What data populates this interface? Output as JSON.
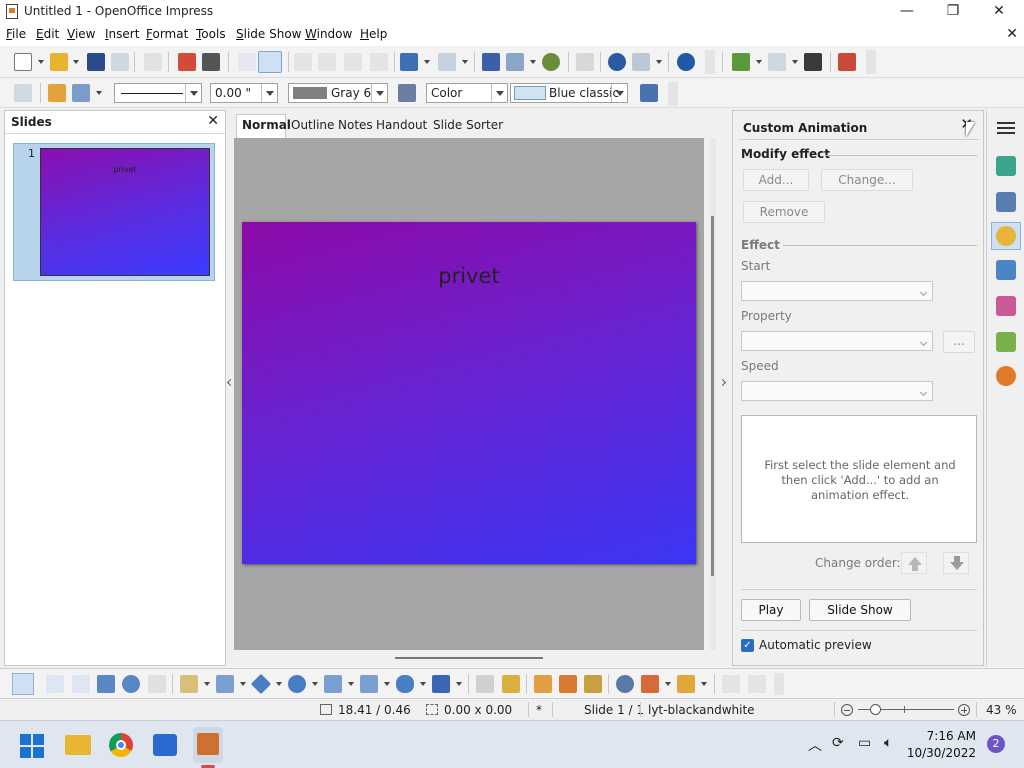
{
  "window": {
    "title": "Untitled 1 - OpenOffice Impress",
    "minimize": "—",
    "maximize": "❐",
    "close": "✕"
  },
  "menu": [
    "File",
    "Edit",
    "View",
    "Insert",
    "Format",
    "Tools",
    "Slide Show",
    "Window",
    "Help"
  ],
  "doc_close": "✕",
  "line_toolbar": {
    "line_width": "0.00 \"",
    "line_color": "Gray 6",
    "area_style": "Color",
    "area_color": "Blue classic"
  },
  "slides_panel": {
    "title": "Slides",
    "close": "✕",
    "slide_number": "1",
    "thumb_text": "privet"
  },
  "view_tabs": [
    "Normal",
    "Outline",
    "Notes",
    "Handout",
    "Slide Sorter"
  ],
  "slide": {
    "title_text": "privet"
  },
  "animation_panel": {
    "title": "Custom Animation",
    "close": "✕",
    "modify_effect": "Modify effect",
    "add": "Add...",
    "change": "Change...",
    "remove": "Remove",
    "effect": "Effect",
    "start": "Start",
    "property": "Property",
    "property_more": "...",
    "speed": "Speed",
    "hint": "First select the slide element and then click 'Add...' to add an animation effect.",
    "change_order": "Change order:",
    "play": "Play",
    "slide_show": "Slide Show",
    "automatic_preview": "Automatic preview"
  },
  "status": {
    "position": "18.41 / 0.46",
    "size": "0.00 x 0.00",
    "modified": "*",
    "slide": "Slide 1 / 1",
    "layout": "lyt-blackandwhite",
    "zoom": "43 %"
  },
  "taskbar": {
    "time": "7:16 AM",
    "date": "10/30/2022",
    "badge": "2"
  },
  "colors": {
    "slide_gradient_top": "#8c0aa8",
    "slide_gradient_bottom": "#3c36f4",
    "line_color_swatch": "#808080",
    "area_color_swatch": "#cfe3f0",
    "check_blue": "#2b6cc4"
  }
}
